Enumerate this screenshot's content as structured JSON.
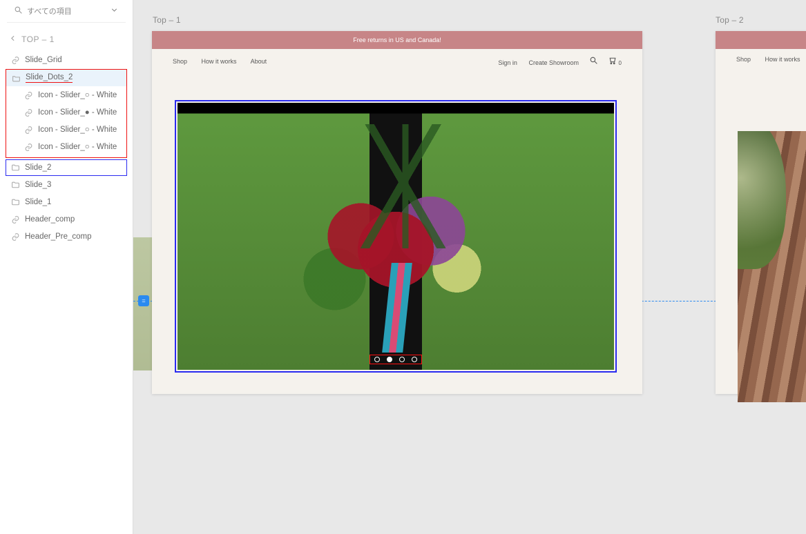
{
  "sidebar": {
    "search_placeholder": "すべての項目",
    "back_label": "TOP – 1",
    "items": [
      {
        "label": "Slide_Grid",
        "icon": "link",
        "depth": 1
      },
      {
        "label": "Slide_Dots_2",
        "icon": "folder-open",
        "depth": 1,
        "selected_bg": true,
        "underline_red": true
      },
      {
        "label": "Icon - Slider_○ - White",
        "icon": "link",
        "depth": 2
      },
      {
        "label": "Icon - Slider_● - White",
        "icon": "link",
        "depth": 2
      },
      {
        "label": "Icon - Slider_○ - White",
        "icon": "link",
        "depth": 2
      },
      {
        "label": "Icon - Slider_○ - White",
        "icon": "link",
        "depth": 2
      },
      {
        "label": "Slide_2",
        "icon": "folder",
        "depth": 1
      },
      {
        "label": "Slide_3",
        "icon": "folder",
        "depth": 1
      },
      {
        "label": "Slide_1",
        "icon": "folder",
        "depth": 1
      },
      {
        "label": "Header_comp",
        "icon": "link",
        "depth": 1
      },
      {
        "label": "Header_Pre_comp",
        "icon": "link",
        "depth": 1
      }
    ]
  },
  "canvas": {
    "frame1_label": "Top – 1",
    "frame2_label": "Top – 2",
    "banner_text": "Free returns in US and Canada!",
    "nav": {
      "shop": "Shop",
      "how": "How it works",
      "about": "About",
      "signin": "Sign in",
      "create": "Create Showroom",
      "cart_count": "0"
    },
    "guide_handle": "="
  }
}
